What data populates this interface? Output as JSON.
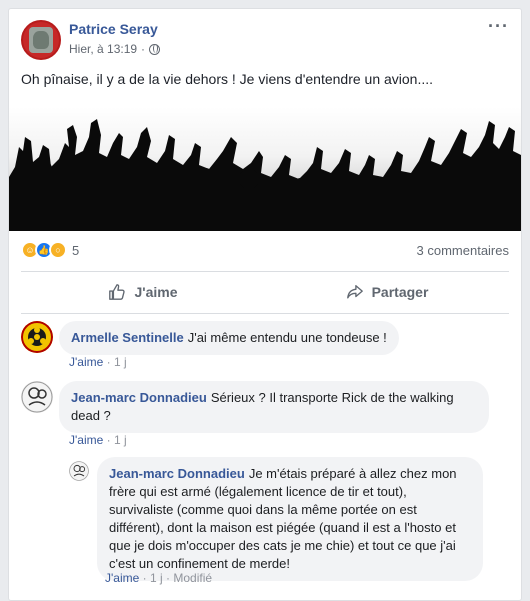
{
  "post": {
    "author": "Patrice Seray",
    "time": "Hier, à 13:19",
    "text": "Oh pînaise, il y a de la vie dehors ! Je viens d'entendre un avion....",
    "reaction_count": "5",
    "comments_count": "3 commentaires"
  },
  "actions": {
    "like": "J'aime",
    "share": "Partager"
  },
  "comments": [
    {
      "name": "Armelle Sentinelle",
      "text": "J'ai même entendu une tondeuse !",
      "like": "J'aime",
      "time": "1 j",
      "edited": ""
    },
    {
      "name": "Jean-marc Donnadieu",
      "text": "Sérieux ? Il transporte Rick de the walking dead ?",
      "like": "J'aime",
      "time": "1 j",
      "edited": ""
    },
    {
      "name": "Jean-marc Donnadieu",
      "text": "Je m'étais préparé à allez chez mon frère qui est armé (légalement licence de tir et tout), survivaliste (comme quoi dans la même portée on est différent), dont la maison est piégée (quand il est a l'hosto et que je dois m'occuper des cats je me chie) et tout ce que j'ai c'est un confinement de merde!",
      "like": "J'aime",
      "time": "1 j",
      "edited": "Modifié"
    }
  ],
  "colors": {
    "link": "#385898",
    "bubble": "#f2f3f5",
    "background": "#e9ebee"
  }
}
